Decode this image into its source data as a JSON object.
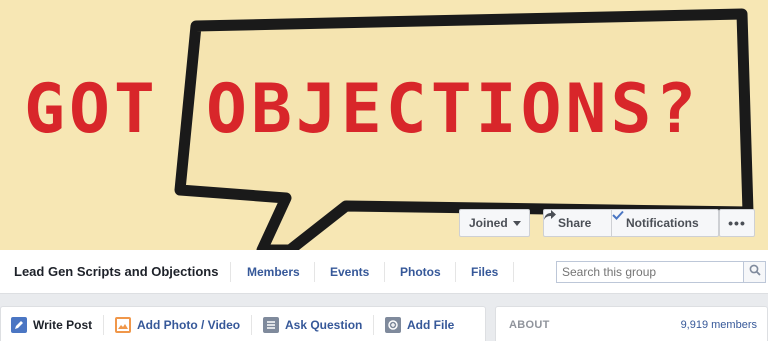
{
  "cover": {
    "headline_left": "GOT",
    "headline_right": "OBJECTIONS?",
    "background_color": "#f7e7b4",
    "text_color": "#d8262a"
  },
  "cover_buttons": {
    "joined": "Joined",
    "share": "Share",
    "notifications": "Notifications",
    "more": "•••"
  },
  "navbar": {
    "group_name": "Lead Gen Scripts and Objections",
    "items": [
      "Members",
      "Events",
      "Photos",
      "Files"
    ],
    "search_placeholder": "Search this group"
  },
  "composer": {
    "items": [
      "Write Post",
      "Add Photo / Video",
      "Ask Question",
      "Add File"
    ]
  },
  "about": {
    "title": "ABOUT",
    "members": "9,919 members"
  },
  "icons": {
    "share": "share-arrow-icon",
    "notifications": "checkmark-icon",
    "search": "magnifier-icon",
    "write_post": "pencil-icon",
    "add_photo": "photo-icon",
    "ask_question": "list-icon",
    "add_file": "file-icon"
  }
}
